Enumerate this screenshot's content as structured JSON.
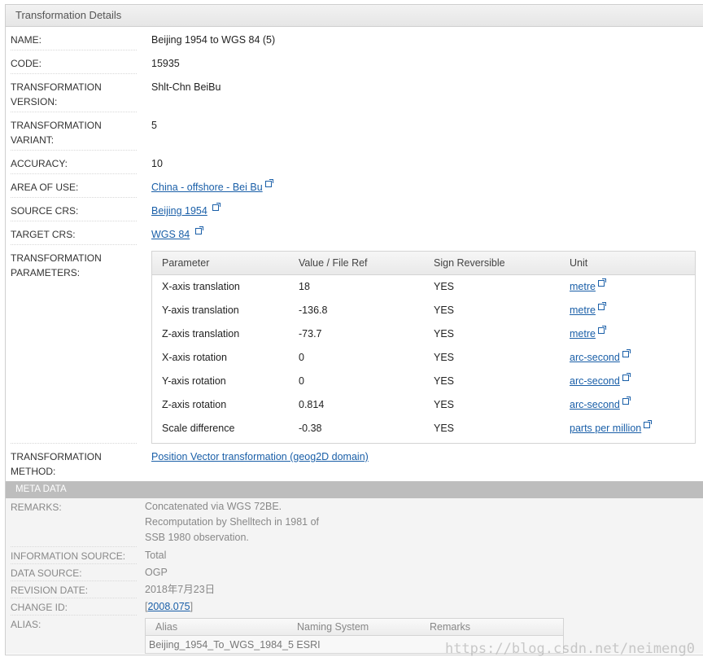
{
  "panel_title": "Transformation Details",
  "fields": {
    "name": {
      "label": "NAME:",
      "value": "Beijing 1954 to WGS 84 (5)"
    },
    "code": {
      "label": "CODE:",
      "value": "15935"
    },
    "version": {
      "label1": "TRANSFORMATION",
      "label2": "VERSION:",
      "value": "Shlt-Chn BeiBu"
    },
    "variant": {
      "label1": "TRANSFORMATION",
      "label2": "VARIANT:",
      "value": "5"
    },
    "accuracy": {
      "label": "ACCURACY:",
      "value": "10"
    },
    "area": {
      "label": "AREA OF USE:",
      "value": "China - offshore - Bei Bu"
    },
    "source_crs": {
      "label": "SOURCE CRS:",
      "value": "Beijing 1954"
    },
    "target_crs": {
      "label": "TARGET CRS:",
      "value": "WGS 84"
    },
    "params": {
      "label1": "TRANSFORMATION",
      "label2": "PARAMETERS:"
    },
    "method": {
      "label1": "TRANSFORMATION",
      "label2": "METHOD:",
      "value": "Position Vector transformation (geog2D domain)"
    }
  },
  "param_table": {
    "headers": [
      "Parameter",
      "Value / File Ref",
      "Sign Reversible",
      "Unit"
    ],
    "rows": [
      {
        "parameter": "X-axis translation",
        "value": "18",
        "sign": "YES",
        "unit": "metre"
      },
      {
        "parameter": "Y-axis translation",
        "value": "-136.8",
        "sign": "YES",
        "unit": "metre"
      },
      {
        "parameter": "Z-axis translation",
        "value": "-73.7",
        "sign": "YES",
        "unit": "metre"
      },
      {
        "parameter": "X-axis rotation",
        "value": "0",
        "sign": "YES",
        "unit": "arc-second"
      },
      {
        "parameter": "Y-axis rotation",
        "value": "0",
        "sign": "YES",
        "unit": "arc-second"
      },
      {
        "parameter": "Z-axis rotation",
        "value": "0.814",
        "sign": "YES",
        "unit": "arc-second"
      },
      {
        "parameter": "Scale difference",
        "value": "-0.38",
        "sign": "YES",
        "unit": "parts per million"
      }
    ]
  },
  "meta": {
    "title": "META DATA",
    "remarks": {
      "label": "REMARKS:",
      "line1": "Concatenated via WGS 72BE.",
      "line2": "Recomputation by Shelltech in 1981 of",
      "line3": "SSB 1980 observation."
    },
    "info_source": {
      "label": "INFORMATION SOURCE:",
      "value": "Total"
    },
    "data_source": {
      "label": "DATA SOURCE:",
      "value": "OGP"
    },
    "revision_date": {
      "label": "REVISION DATE:",
      "value": "2018年7月23日"
    },
    "change_id": {
      "label": "CHANGE ID:",
      "prefix": "[",
      "value": "2008.075",
      "suffix": "]"
    },
    "alias": {
      "label": "ALIAS:",
      "headers": [
        "Alias",
        "Naming System",
        "Remarks"
      ],
      "row": {
        "alias": "Beijing_1954_To_WGS_1984_5",
        "naming_system": "ESRI",
        "remarks": ""
      }
    }
  },
  "watermark": "https://blog.csdn.net/neimeng0",
  "colors": {
    "link": "#1a5fa8",
    "meta_header": "#bdbdbd",
    "meta_bg": "#f4f4f4"
  }
}
